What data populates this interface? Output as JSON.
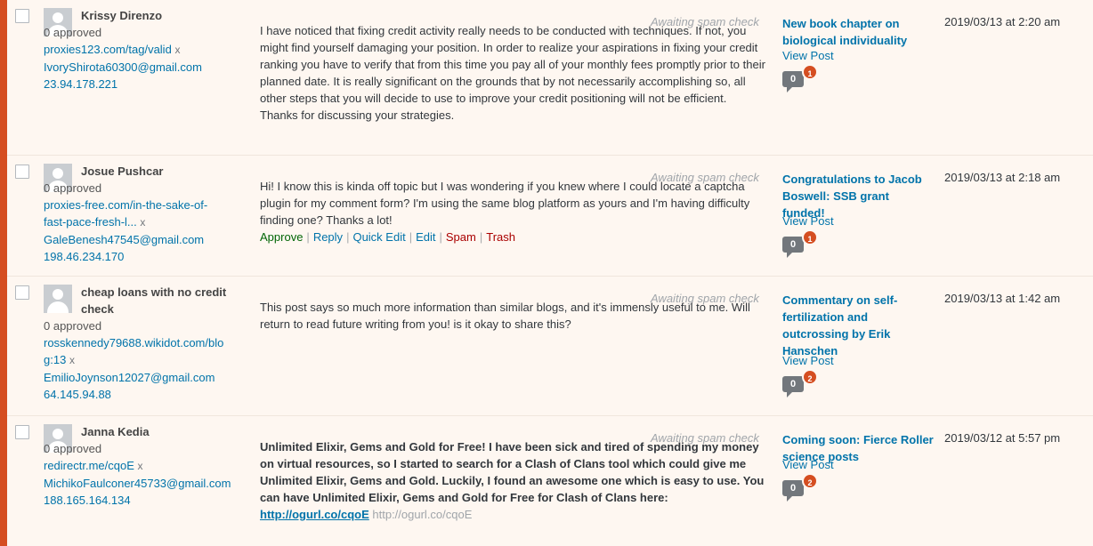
{
  "comments": [
    {
      "author": "Krissy Direnzo",
      "approved": "0 approved",
      "url_line1": "proxies123.com/tag/valid",
      "url_line2": "",
      "email": "IvoryShirota60300@gmail.com",
      "ip": "23.94.178.221",
      "status": "Awaiting spam check",
      "text": "I have noticed that fixing credit activity really needs to be conducted with techniques. If not, you might find yourself damaging your position. In order to realize your aspirations in fixing your credit ranking you have to verify that from this time you pay all of your monthly fees promptly prior to their planned date. It is really significant on the grounds that by not necessarily accomplishing so, all other steps that you will decide to use to improve your credit positioning will not be efficient. Thanks for discussing your strategies.",
      "post_title": "New book chapter on biological individuality",
      "view_post": "View Post",
      "approved_count": "0",
      "pending_count": "1",
      "date": "2019/03/13 at 2:20 am"
    },
    {
      "author": "Josue Pushcar",
      "approved": "0 approved",
      "url_line1": "proxies-free.com/in-the-sake-of-",
      "url_line2": "fast-pace-fresh-l...",
      "email": "GaleBenesh47545@gmail.com",
      "ip": "198.46.234.170",
      "status": "Awaiting spam check",
      "text": "Hi! I know this is kinda off topic but I was wondering if you knew where I could locate a captcha plugin for my comment form? I'm using the same blog platform as yours and I'm having difficulty finding one? Thanks a lot!",
      "actions": {
        "approve": "Approve",
        "reply": "Reply",
        "quick_edit": "Quick Edit",
        "edit": "Edit",
        "spam": "Spam",
        "trash": "Trash"
      },
      "post_title": "Congratulations to Jacob Boswell: SSB grant funded!",
      "view_post": "View Post",
      "approved_count": "0",
      "pending_count": "1",
      "date": "2019/03/13 at 2:18 am"
    },
    {
      "author": "cheap loans with no credit check",
      "approved": "0 approved",
      "url_line1": "rosskennedy79688.wikidot.com/blo",
      "url_line2": "g:13",
      "email": "EmilioJoynson12027@gmail.com",
      "ip": "64.145.94.88",
      "status": "Awaiting spam check",
      "text": "This post says so much more information than similar blogs, and it's immensly useful to me. Will return to read future writing from you! is it okay to share this?",
      "post_title": "Commentary on self-fertilization and outcrossing by Erik Hanschen",
      "view_post": "View Post",
      "approved_count": "0",
      "pending_count": "2",
      "date": "2019/03/13 at 1:42 am"
    },
    {
      "author": "Janna Kedia",
      "approved": "0 approved",
      "url_line1": "redirectr.me/cqoE",
      "url_line2": "",
      "email": "MichikoFaulconer45733@gmail.com",
      "ip": "188.165.164.134",
      "status": "Awaiting spam check",
      "text": "Unlimited Elixir, Gems and Gold for Free! I have been sick and tired of spending my money on virtual resources, so I started to search for a Clash of Clans tool which could give me Unlimited Elixir, Gems and Gold. Luckily, I found an awesome one which is easy to use. You can have Unlimited Elixir, Gems and Gold for Free for Clash of Clans here:",
      "link_text": "http://ogurl.co/cqoE",
      "link_url_grey": "http://ogurl.co/cqoE",
      "post_title": "Coming soon: Fierce Roller science posts",
      "view_post": "View Post",
      "approved_count": "0",
      "pending_count": "2",
      "date": "2019/03/12 at 5:57 pm"
    }
  ],
  "remove_mark": "x",
  "colors": {
    "accent_bar": "#d54e21",
    "link": "#0073aa",
    "row_bg": "#fef7f1"
  }
}
